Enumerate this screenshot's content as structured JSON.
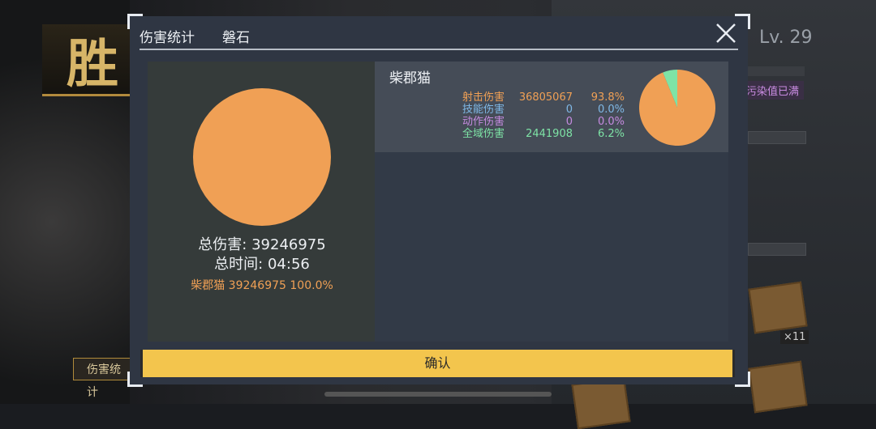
{
  "background": {
    "victory_text": "胜",
    "level": "Lv. 29",
    "infection_text": "污染值已满",
    "damage_stats_button": "伤害统计",
    "item_count": "×11"
  },
  "dialog": {
    "title": "伤害统计",
    "stage": "磐石",
    "total_damage_label": "总伤害:",
    "total_damage": "39246975",
    "total_time_label": "总时间:",
    "total_time": "04:56",
    "share": {
      "name": "柴郡猫",
      "damage": "39246975",
      "percent": "100.0%"
    },
    "character": {
      "name": "柴郡猫",
      "stats": [
        {
          "label": "射击伤害",
          "value": "36805067",
          "percent": "93.8%",
          "fraction": 0.938,
          "color": "#f0a055"
        },
        {
          "label": "技能伤害",
          "value": "0",
          "percent": "0.0%",
          "fraction": 0.0,
          "color": "#7fb8e6"
        },
        {
          "label": "动作伤害",
          "value": "0",
          "percent": "0.0%",
          "fraction": 0.0,
          "color": "#c58be0"
        },
        {
          "label": "全域伤害",
          "value": "2441908",
          "percent": "6.2%",
          "fraction": 0.062,
          "color": "#7ee3a6"
        }
      ]
    },
    "confirm_label": "确认"
  },
  "icons": {
    "close": "close-x-icon"
  }
}
